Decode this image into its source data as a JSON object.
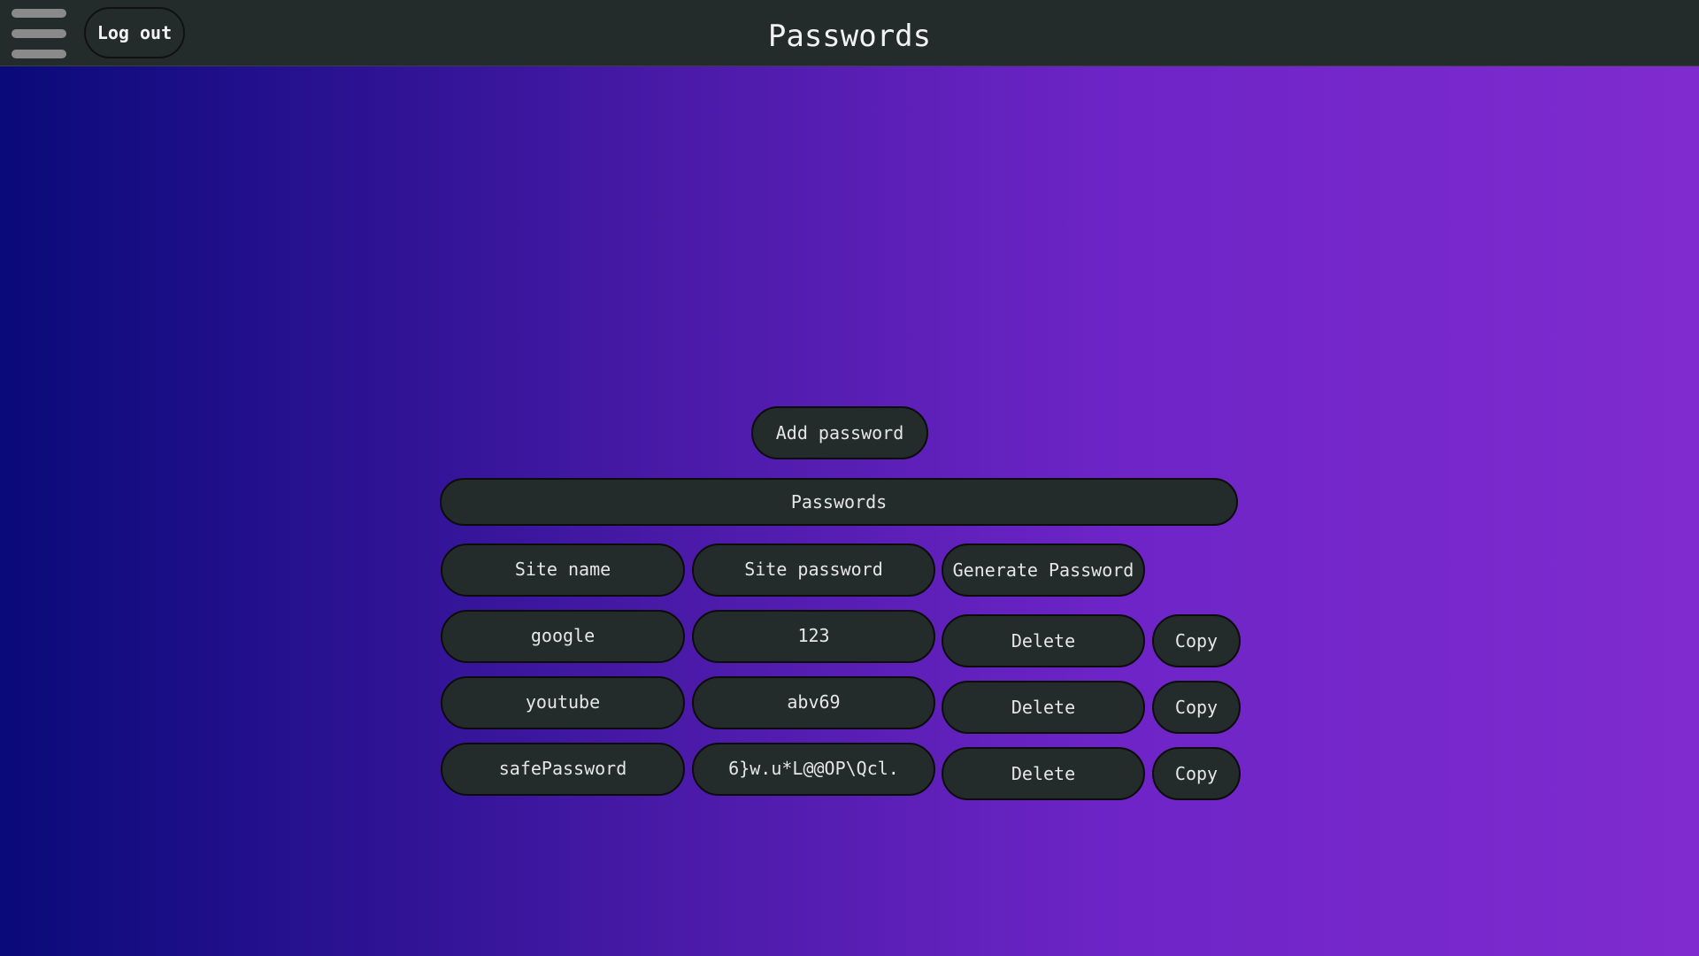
{
  "header": {
    "title": "Passwords",
    "logout_label": "Log out"
  },
  "main": {
    "add_button_label": "Add password",
    "section_title": "Passwords",
    "columns": {
      "site_name": "Site name",
      "site_password": "Site password",
      "generate_label": "Generate Password"
    },
    "rows": [
      {
        "site": "google",
        "password": "123",
        "delete_label": "Delete",
        "copy_label": "Copy"
      },
      {
        "site": "youtube",
        "password": "abv69",
        "delete_label": "Delete",
        "copy_label": "Copy"
      },
      {
        "site": "safePassword",
        "password": "6}w.u*L@@OP\\Qcl.",
        "delete_label": "Delete",
        "copy_label": "Copy"
      }
    ]
  },
  "icons": {
    "menu": "hamburger-menu-icon"
  },
  "colors": {
    "bar_background": "#232b2b",
    "gradient_start": "#0a0a7a",
    "gradient_end": "#7f2bd0",
    "text": "#e6e6e6"
  }
}
